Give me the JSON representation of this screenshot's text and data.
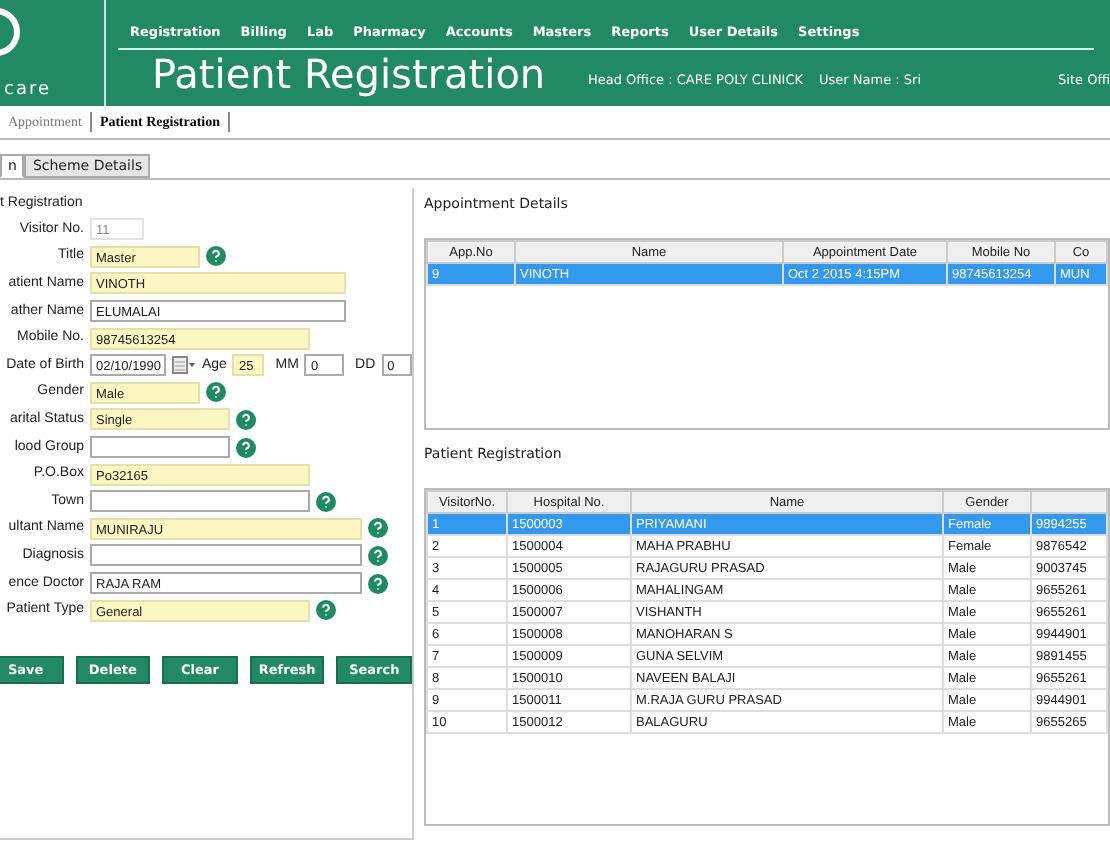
{
  "header": {
    "logo_text": "care",
    "menu": [
      "Registration",
      "Billing",
      "Lab",
      "Pharmacy",
      "Accounts",
      "Masters",
      "Reports",
      "User Details",
      "Settings"
    ],
    "title": "Patient Registration",
    "head_office": "Head Office :  CARE POLY CLINICK",
    "user_name": "User Name : Sri",
    "site_office": "Site Offi"
  },
  "tabs": [
    {
      "label": "Appointment",
      "selected": false
    },
    {
      "label": "Patient Registration",
      "selected": true
    }
  ],
  "sub_tabs": [
    {
      "label": "n",
      "selected": true
    },
    {
      "label": "Scheme Details",
      "selected": false
    }
  ],
  "form": {
    "title": "t Registration",
    "fields": [
      {
        "kind": "text",
        "label": "Visitor No.",
        "value": "11",
        "required": false,
        "help": false,
        "disabled": true
      },
      {
        "kind": "text",
        "label": "Title",
        "value": "Master",
        "required": true,
        "help": true,
        "disabled": false
      },
      {
        "kind": "text",
        "label": "atient Name",
        "value": "VINOTH",
        "required": true,
        "help": false,
        "disabled": false
      },
      {
        "kind": "text",
        "label": "ather Name",
        "value": "ELUMALAI",
        "required": false,
        "help": false,
        "disabled": false
      },
      {
        "kind": "text",
        "label": "Mobile No.",
        "value": "98745613254",
        "required": true,
        "help": false,
        "disabled": false
      },
      {
        "kind": "dob",
        "label": "Date of Birth",
        "value": "02/10/1990",
        "age_label": "Age",
        "age": "25",
        "mm_label": "MM",
        "mm": "0",
        "dd_label": "DD",
        "dd": "0"
      },
      {
        "kind": "text",
        "label": "Gender",
        "value": "Male",
        "required": true,
        "help": true,
        "disabled": false
      },
      {
        "kind": "text",
        "label": "arital Status",
        "value": "Single",
        "required": true,
        "help": true,
        "disabled": false
      },
      {
        "kind": "text",
        "label": "lood Group",
        "required": false,
        "help": true,
        "disabled": false
      },
      {
        "kind": "text",
        "label": "P.O.Box",
        "value": "Po32165",
        "required": true,
        "help": false,
        "disabled": false
      },
      {
        "kind": "text",
        "label": "Town",
        "required": false,
        "help": true,
        "disabled": false
      },
      {
        "kind": "text",
        "label": "ultant Name",
        "value": "MUNIRAJU",
        "required": true,
        "help": true,
        "disabled": false
      },
      {
        "kind": "text",
        "label": "Diagnosis",
        "required": false,
        "help": true,
        "disabled": false
      },
      {
        "kind": "text",
        "label": "ence Doctor",
        "value": "RAJA RAM",
        "required": false,
        "help": true,
        "disabled": false
      },
      {
        "kind": "text",
        "label": "Patient Type",
        "value": "General",
        "required": true,
        "help": true,
        "disabled": false
      }
    ],
    "buttons": [
      "Save",
      "Delete",
      "Clear",
      "Refresh",
      "Search"
    ]
  },
  "appointments": {
    "title": "Appointment Details",
    "columns": [
      "App.No",
      "Name",
      "Appointment Date",
      "Mobile No",
      "Co"
    ],
    "rows": [
      {
        "cells": [
          "9",
          "VINOTH",
          "Oct  2 2015  4:15PM",
          "98745613254",
          "MUN"
        ],
        "selected": true
      }
    ]
  },
  "patients": {
    "title": "Patient Registration",
    "columns": [
      "VisitorNo.",
      "Hospital No.",
      "Name",
      "Gender"
    ],
    "rows": [
      {
        "cells": [
          "1",
          "1500003",
          "PRIYAMANI",
          "Female",
          "9894255"
        ],
        "selected": true
      },
      {
        "cells": [
          "2",
          "1500004",
          "MAHA PRABHU",
          "Female",
          "9876542"
        ],
        "selected": false
      },
      {
        "cells": [
          "3",
          "1500005",
          "RAJAGURU PRASAD",
          "Male",
          "9003745"
        ],
        "selected": false
      },
      {
        "cells": [
          "4",
          "1500006",
          "MAHALINGAM",
          "Male",
          "9655261"
        ],
        "selected": false
      },
      {
        "cells": [
          "5",
          "1500007",
          "VISHANTH",
          "Male",
          "9655261"
        ],
        "selected": false
      },
      {
        "cells": [
          "6",
          "1500008",
          "MANOHARAN S",
          "Male",
          "9944901"
        ],
        "selected": false
      },
      {
        "cells": [
          "7",
          "1500009",
          "GUNA SELVIM",
          "Male",
          "9891455"
        ],
        "selected": false
      },
      {
        "cells": [
          "8",
          "1500010",
          "NAVEEN BALAJI",
          "Male",
          "9655261"
        ],
        "selected": false
      },
      {
        "cells": [
          "9",
          "1500011",
          "M.RAJA GURU PRASAD",
          "Male",
          "9944901"
        ],
        "selected": false
      },
      {
        "cells": [
          "10",
          "1500012",
          "BALAGURU",
          "Male",
          "9655265"
        ],
        "selected": false
      }
    ]
  }
}
